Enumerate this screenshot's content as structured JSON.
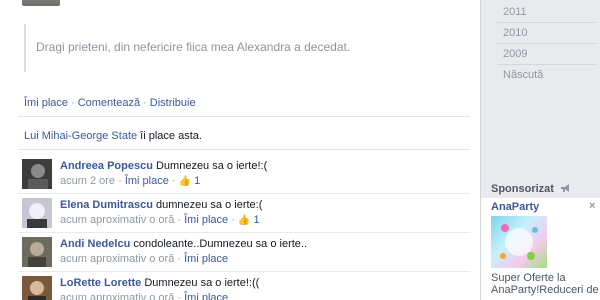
{
  "post": {
    "quote_text": "Dragi prieteni, din nefericire fiica mea Alexandra a decedat.",
    "actions": {
      "like": "Îmi place",
      "comment": "Comentează",
      "share": "Distribuie"
    },
    "likes_summary": {
      "name": "Lui Mihai-George State",
      "suffix": " îi place asta."
    }
  },
  "comments": [
    {
      "author": "Andreea Popescu",
      "text": "Dumnezeu sa o ierte!:(",
      "time": "acum 2 ore",
      "like_label": "Îmi place",
      "like_count": "1"
    },
    {
      "author": "Elena Dumitrascu",
      "text": "dumnezeu sa o ierte:(",
      "time": "acum aproximativ o oră",
      "like_label": "Îmi place",
      "like_count": "1"
    },
    {
      "author": "Andi Nedelcu",
      "text": "condoleante..Dumnezeu sa o ierte..",
      "time": "acum aproximativ o oră",
      "like_label": "Îmi place",
      "like_count": ""
    },
    {
      "author": "LoRette Lorette",
      "text": "Dumnezeu sa o ierte!:((",
      "time": "acum aproximativ o oră",
      "like_label": "Îmi place",
      "like_count": ""
    }
  ],
  "sidebar": {
    "timeline_years": [
      "2011",
      "2010",
      "2009",
      "Născută"
    ],
    "sponsored_heading": "Sponsorizat",
    "ad": {
      "title": "AnaParty",
      "close": "×",
      "text": "Super Oferte la AnaParty!Reduceri de"
    }
  },
  "colors": {
    "link": "#3b5998",
    "muted": "#9197a3",
    "sidebar_bg": "#e9eaed"
  }
}
